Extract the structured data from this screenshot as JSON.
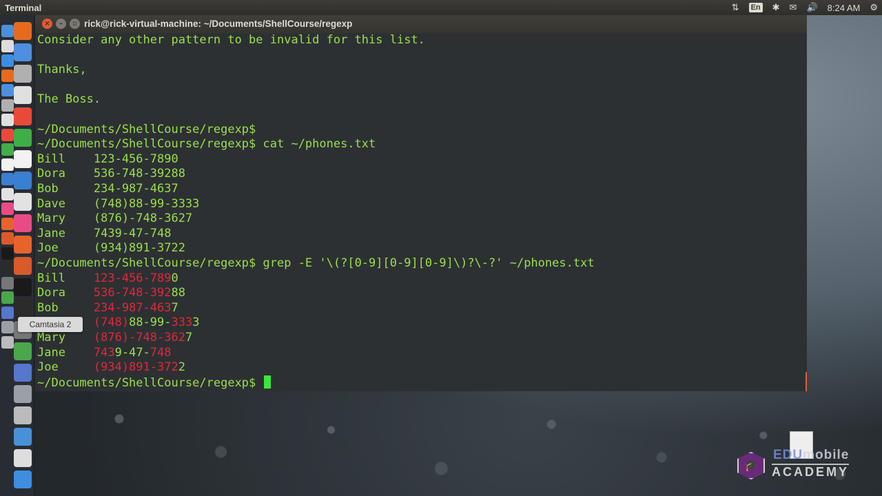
{
  "top_panel": {
    "app_title": "Terminal",
    "indicators": {
      "network_icon": "⇅",
      "language": "En",
      "bluetooth_icon": "✱",
      "mail_icon": "✉",
      "volume_icon": "🔊",
      "clock": "8:24 AM",
      "settings_icon": "⚙"
    }
  },
  "tooltip": {
    "text": "Camtasia 2"
  },
  "terminal": {
    "title": "rick@rick-virtual-machine: ~/Documents/ShellCourse/regexp",
    "buttons": {
      "close": "×",
      "minimize": "–",
      "maximize": "▫"
    },
    "lines": [
      {
        "segments": [
          {
            "text": "Consider any other pattern to be invalid for this list."
          }
        ]
      },
      {
        "segments": [
          {
            "text": ""
          }
        ]
      },
      {
        "segments": [
          {
            "text": "Thanks,"
          }
        ]
      },
      {
        "segments": [
          {
            "text": ""
          }
        ]
      },
      {
        "segments": [
          {
            "text": "The Boss."
          }
        ]
      },
      {
        "segments": [
          {
            "text": ""
          }
        ]
      },
      {
        "segments": [
          {
            "text": "~/Documents/ShellCourse/regexp$"
          }
        ]
      },
      {
        "segments": [
          {
            "text": "~/Documents/ShellCourse/regexp$ cat ~/phones.txt"
          }
        ]
      },
      {
        "segments": [
          {
            "text": "Bill    123-456-7890"
          }
        ]
      },
      {
        "segments": [
          {
            "text": "Dora    536-748-39288"
          }
        ]
      },
      {
        "segments": [
          {
            "text": "Bob     234-987-4637"
          }
        ]
      },
      {
        "segments": [
          {
            "text": "Dave    (748)88-99-3333"
          }
        ]
      },
      {
        "segments": [
          {
            "text": "Mary    (876)-748-3627"
          }
        ]
      },
      {
        "segments": [
          {
            "text": "Jane    7439-47-748"
          }
        ]
      },
      {
        "segments": [
          {
            "text": "Joe     (934)891-3722"
          }
        ]
      },
      {
        "segments": [
          {
            "text": "~/Documents/ShellCourse/regexp$ grep -E '\\(?[0-9][0-9][0-9]\\)?\\-?' ~/phones.txt"
          }
        ]
      },
      {
        "segments": [
          {
            "text": "Bill    "
          },
          {
            "text": "123-456-789",
            "hl": true
          },
          {
            "text": "0"
          }
        ]
      },
      {
        "segments": [
          {
            "text": "Dora    "
          },
          {
            "text": "536-748-392",
            "hl": true
          },
          {
            "text": "88"
          }
        ]
      },
      {
        "segments": [
          {
            "text": "Bob     "
          },
          {
            "text": "234-987-463",
            "hl": true
          },
          {
            "text": "7"
          }
        ]
      },
      {
        "segments": [
          {
            "text": "Dave    "
          },
          {
            "text": "(748)",
            "hl": true
          },
          {
            "text": "88-99-"
          },
          {
            "text": "333",
            "hl": true
          },
          {
            "text": "3"
          }
        ]
      },
      {
        "segments": [
          {
            "text": "Mary    "
          },
          {
            "text": "(876)-748-362",
            "hl": true
          },
          {
            "text": "7"
          }
        ]
      },
      {
        "segments": [
          {
            "text": "Jane    "
          },
          {
            "text": "743",
            "hl": true
          },
          {
            "text": "9-47-"
          },
          {
            "text": "748",
            "hl": true
          }
        ]
      },
      {
        "segments": [
          {
            "text": "Joe     "
          },
          {
            "text": "(934)891-372",
            "hl": true
          },
          {
            "text": "2"
          }
        ]
      },
      {
        "segments": [
          {
            "text": "~/Documents/ShellCourse/regexp$ "
          }
        ],
        "cursor": true
      }
    ]
  },
  "launcher": {
    "icons": [
      "dash-icon",
      "settings-icon",
      "compass-icon",
      "firefox-icon",
      "mail-icon",
      "files-icon",
      "calendar-icon",
      "chart-icon",
      "spreadsheet-icon",
      "document-icon",
      "text-editor-icon",
      "photos-icon",
      "music-icon",
      "presentation-icon",
      "software-center-icon",
      "amazon-icon",
      "terminal-icon",
      "system-settings-icon",
      "camtasia-icon",
      "workspace-icon",
      "disk-icon",
      "trash-icon"
    ]
  },
  "watermark": {
    "line1_edu": "EDU",
    "line1_rest": "mobile",
    "line2": "ACADEMY"
  },
  "colors": {
    "terminal_text": "#99e04a",
    "match_highlight": "#e0283a",
    "terminal_bg": "#2d3033"
  }
}
